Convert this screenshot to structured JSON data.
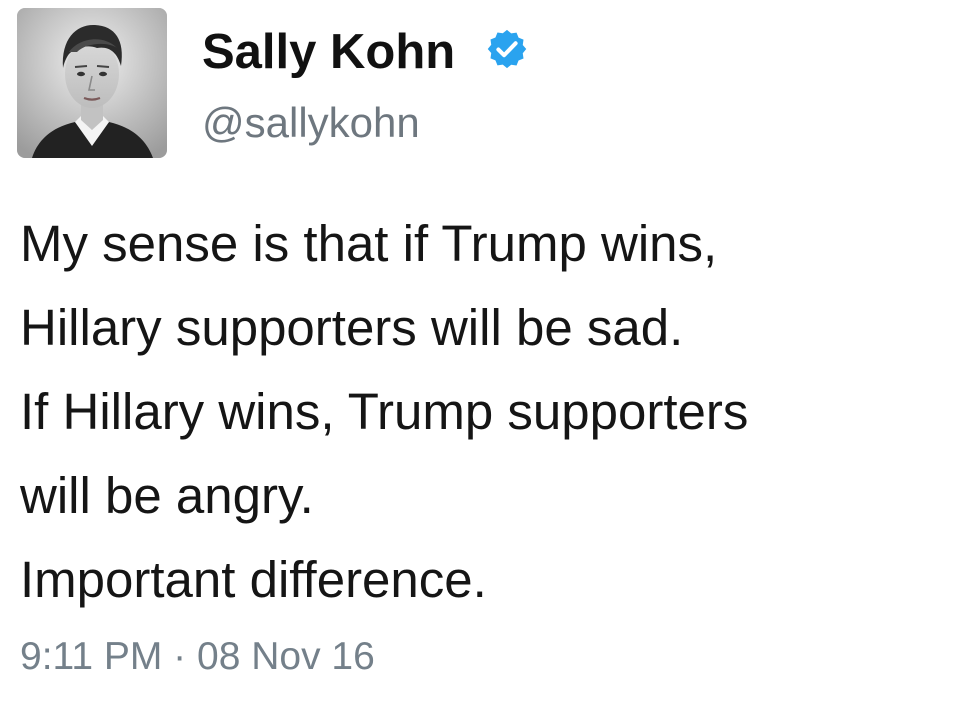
{
  "tweet": {
    "author": {
      "display_name": "Sally Kohn",
      "handle": "@sallykohn",
      "verified_icon": "verified-badge-icon",
      "verified_color": "#1da1f2",
      "avatar_icon": "profile-photo"
    },
    "text_lines": [
      "My sense is that if Trump wins,",
      "Hillary supporters will be sad.",
      "If Hillary wins, Trump supporters",
      "will be angry.",
      "Important difference."
    ],
    "timestamp": "9:11 PM · 08 Nov 16"
  }
}
